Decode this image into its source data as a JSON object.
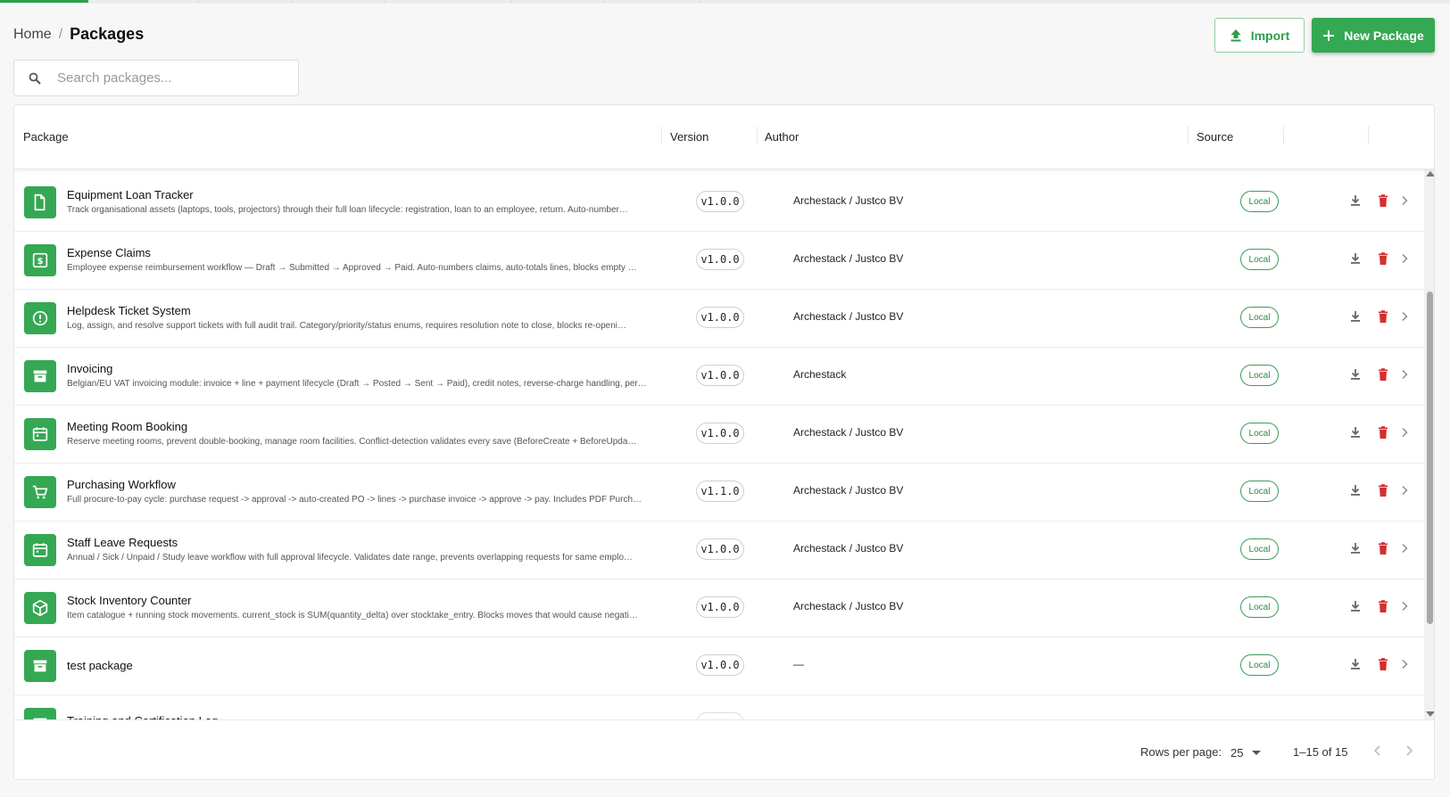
{
  "breadcrumb": {
    "home": "Home",
    "separator": "/",
    "current": "Packages"
  },
  "actions": {
    "import_label": "Import",
    "new_label": "New Package"
  },
  "search": {
    "placeholder": "Search packages..."
  },
  "table": {
    "columns": {
      "package": "Package",
      "version": "Version",
      "author": "Author",
      "source": "Source"
    },
    "rows": [
      {
        "icon": "document-icon",
        "name": "Equipment Loan Tracker",
        "description": "Track organisational assets (laptops, tools, projectors) through their full loan lifecycle: registration, loan to an employee, return. Auto-number…",
        "version": "v1.0.0",
        "author": "Archestack / Justco BV",
        "source": "Local"
      },
      {
        "icon": "dollar-icon",
        "name": "Expense Claims",
        "description": "Employee expense reimbursement workflow — Draft → Submitted → Approved → Paid. Auto-numbers claims, auto-totals lines, blocks empty …",
        "version": "v1.0.0",
        "author": "Archestack / Justco BV",
        "source": "Local"
      },
      {
        "icon": "alert-circle-icon",
        "name": "Helpdesk Ticket System",
        "description": "Log, assign, and resolve support tickets with full audit trail. Category/priority/status enums, requires resolution note to close, blocks re-openi…",
        "version": "v1.0.0",
        "author": "Archestack / Justco BV",
        "source": "Local"
      },
      {
        "icon": "archive-icon",
        "name": "Invoicing",
        "description": "Belgian/EU VAT invoicing module: invoice + line + payment lifecycle (Draft → Posted → Sent → Paid), credit notes, reverse-charge handling, per…",
        "version": "v1.0.0",
        "author": "Archestack",
        "source": "Local"
      },
      {
        "icon": "calendar-icon",
        "name": "Meeting Room Booking",
        "description": "Reserve meeting rooms, prevent double-booking, manage room facilities. Conflict-detection validates every save (BeforeCreate + BeforeUpda…",
        "version": "v1.0.0",
        "author": "Archestack / Justco BV",
        "source": "Local"
      },
      {
        "icon": "cart-icon",
        "name": "Purchasing Workflow",
        "description": "Full procure-to-pay cycle: purchase request -> approval -> auto-created PO -> lines -> purchase invoice -> approve -> pay. Includes PDF Purch…",
        "version": "v1.1.0",
        "author": "Archestack / Justco BV",
        "source": "Local"
      },
      {
        "icon": "calendar-icon",
        "name": "Staff Leave Requests",
        "description": "Annual / Sick / Unpaid / Study leave workflow with full approval lifecycle. Validates date range, prevents overlapping requests for same emplo…",
        "version": "v1.0.0",
        "author": "Archestack / Justco BV",
        "source": "Local"
      },
      {
        "icon": "box-icon",
        "name": "Stock Inventory Counter",
        "description": "Item catalogue + running stock movements. current_stock is SUM(quantity_delta) over stocktake_entry. Blocks moves that would cause negati…",
        "version": "v1.0.0",
        "author": "Archestack / Justco BV",
        "source": "Local"
      },
      {
        "icon": "archive-icon",
        "name": "test package",
        "description": "",
        "version": "v1.0.0",
        "author": "—",
        "source": "Local"
      },
      {
        "icon": "archive-icon",
        "name": "Training and Certification Log",
        "description": "",
        "version": "",
        "author": "",
        "source": ""
      }
    ]
  },
  "pagination": {
    "rows_per_page_label": "Rows per page:",
    "rows_per_page": "25",
    "range": "1–15 of 15"
  },
  "colors": {
    "accent": "#35a853",
    "delete": "#d32f2f",
    "source_badge": "#3b9d55"
  }
}
